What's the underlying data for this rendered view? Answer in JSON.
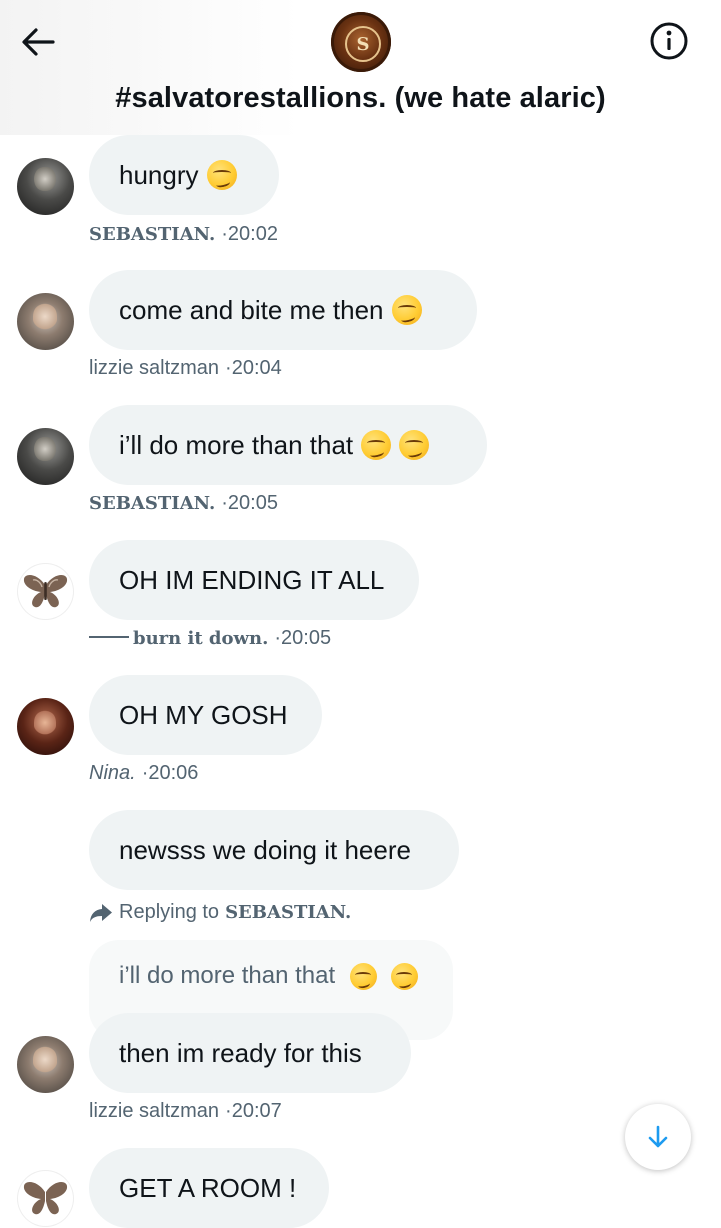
{
  "header": {
    "title": "#salvatorestallions. (we hate alaric)",
    "avatar_letter": "S",
    "back_icon": "arrow-left-icon",
    "info_icon": "info-circle-icon"
  },
  "messages": [
    {
      "text": "hungry",
      "emojis": 1,
      "author": "SEBASTIAN.",
      "time": "·20:02"
    },
    {
      "text": "come and bite me then",
      "emojis": 1,
      "author": "lizzie saltzman",
      "time": "·20:04"
    },
    {
      "text": "i’ll do more than that",
      "emojis": 2,
      "author": "SEBASTIAN.",
      "time": "·20:05"
    },
    {
      "text": "OH IM ENDING IT ALL",
      "author": "burn it down.",
      "time": "·20:05"
    },
    {
      "text": "OH MY GOSH",
      "author": "Nina.",
      "time": "·20:06"
    },
    {
      "text": "newsss we doing it heere"
    },
    {
      "text": "then im ready for this",
      "author": "lizzie saltzman",
      "time": "·20:07"
    },
    {
      "text": "GET A ROOM !"
    }
  ],
  "reply": {
    "prefix": "Replying to",
    "name": "SEBASTIAN.",
    "quoted_text": "i’ll do more than that"
  },
  "colors": {
    "bubble": "#eff3f4",
    "secondary_text": "#536471",
    "accent": "#1d9bf0"
  },
  "scroll_button_icon": "arrow-down-icon"
}
